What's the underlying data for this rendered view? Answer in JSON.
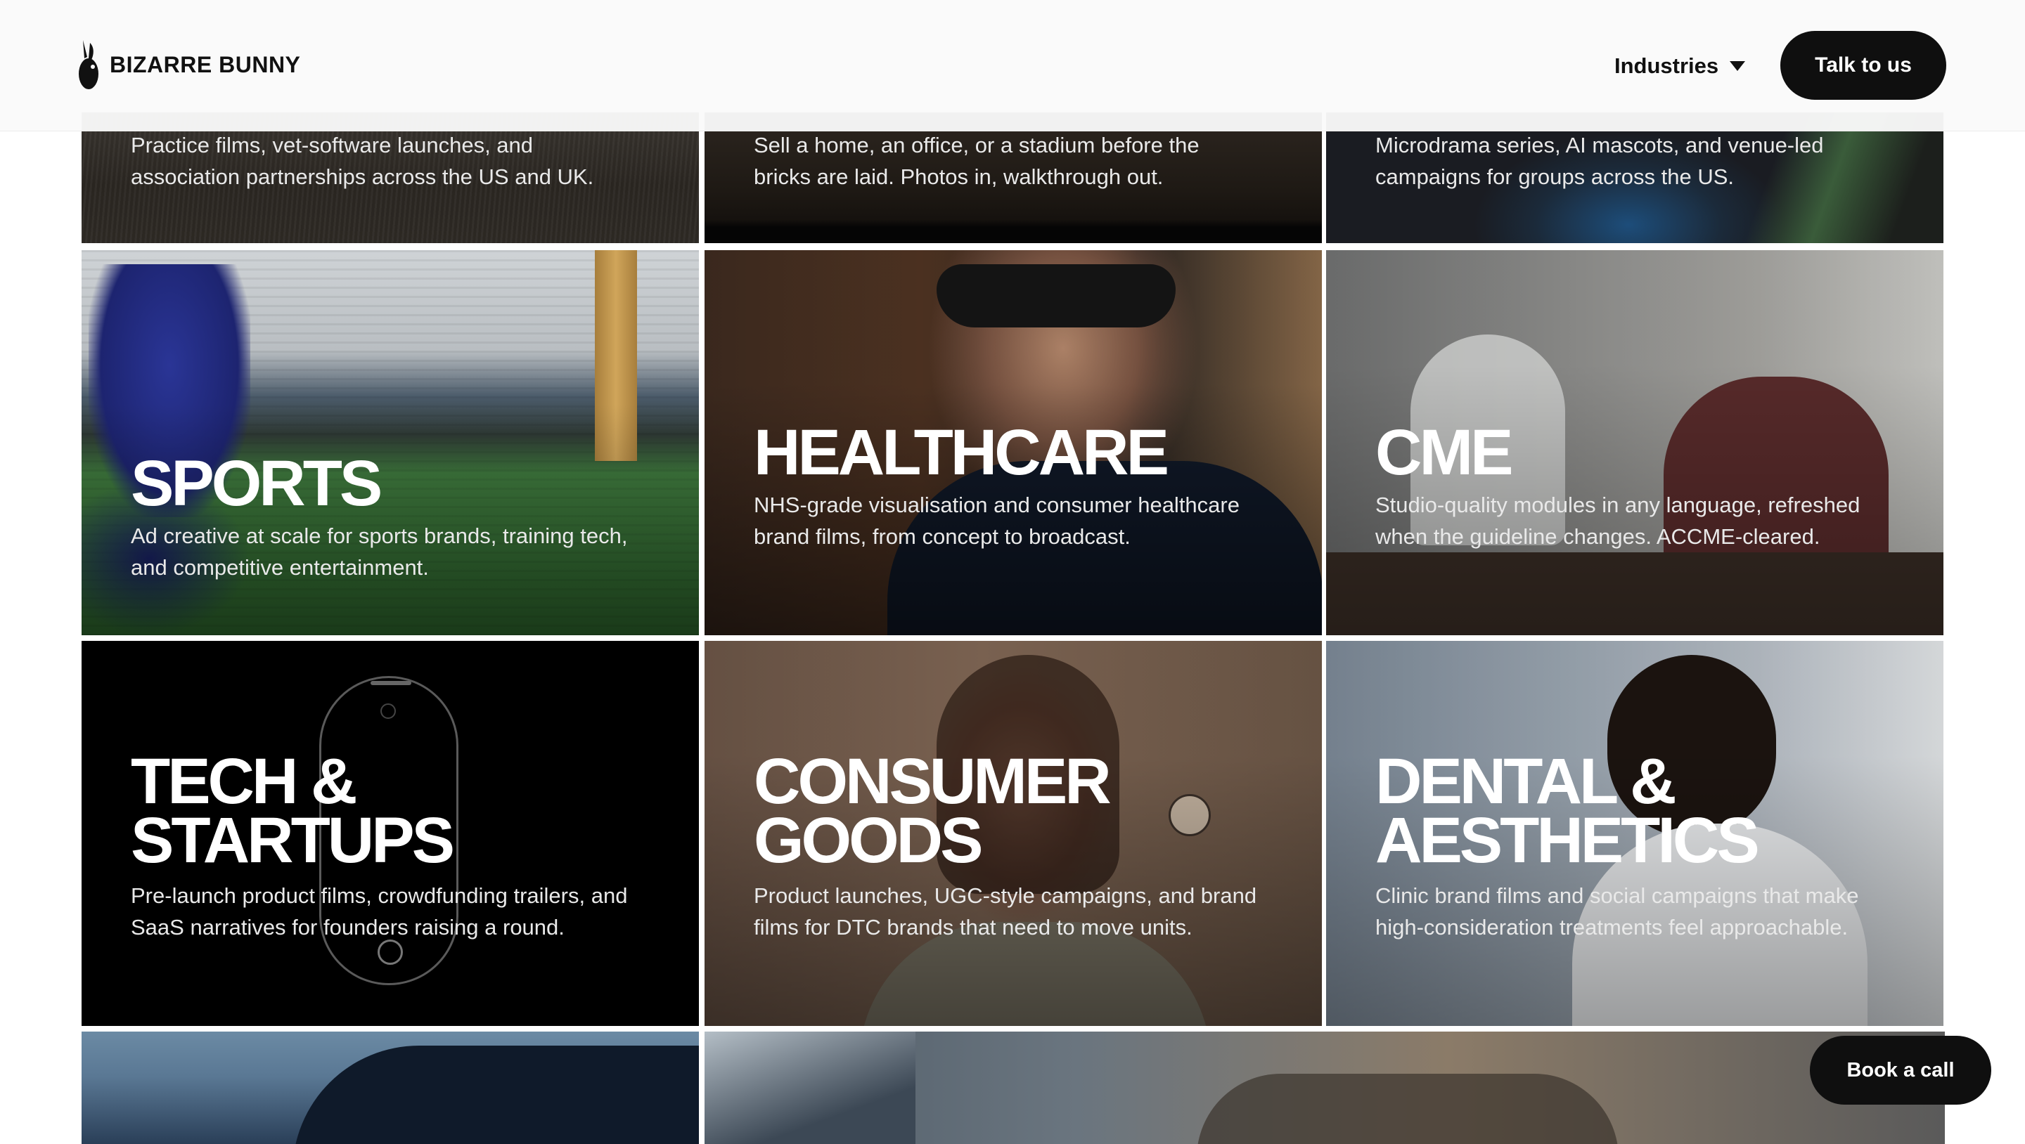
{
  "brand": {
    "name": "BIZARRE BUNNY",
    "logo_icon": "bunny-logo-icon"
  },
  "nav": {
    "industries_label": "Industries",
    "cta_label": "Talk to us"
  },
  "partial_top_row": [
    {
      "desc": "Practice films, vet-software launches, and association partnerships across the US and UK."
    },
    {
      "desc": "Sell a home, an office, or a stadium before the bricks are laid. Photos in, walkthrough out."
    },
    {
      "desc": "Microdrama series, AI mascots, and venue-led campaigns for groups across the US."
    }
  ],
  "cards": [
    {
      "title": "SPORTS",
      "desc": "Ad creative at scale for sports brands, training tech, and competitive entertainment."
    },
    {
      "title": "HEALTHCARE",
      "desc": "NHS-grade visualisation and consumer healthcare brand films, from concept to broadcast."
    },
    {
      "title": "CME",
      "desc": "Studio-quality modules in any language, refreshed when the guideline changes. ACCME-cleared."
    },
    {
      "title": "TECH & STARTUPS",
      "desc": "Pre-launch product films, crowdfunding trailers, and SaaS narratives for founders raising a round."
    },
    {
      "title": "CONSUMER GOODS",
      "desc": "Product launches, UGC-style campaigns, and brand films for DTC brands that need to move units."
    },
    {
      "title": "DENTAL & AESTHETICS",
      "desc": "Clinic brand films and social campaigns that make high-consideration treatments feel approachable."
    }
  ],
  "floating": {
    "book_label": "Book a call"
  }
}
